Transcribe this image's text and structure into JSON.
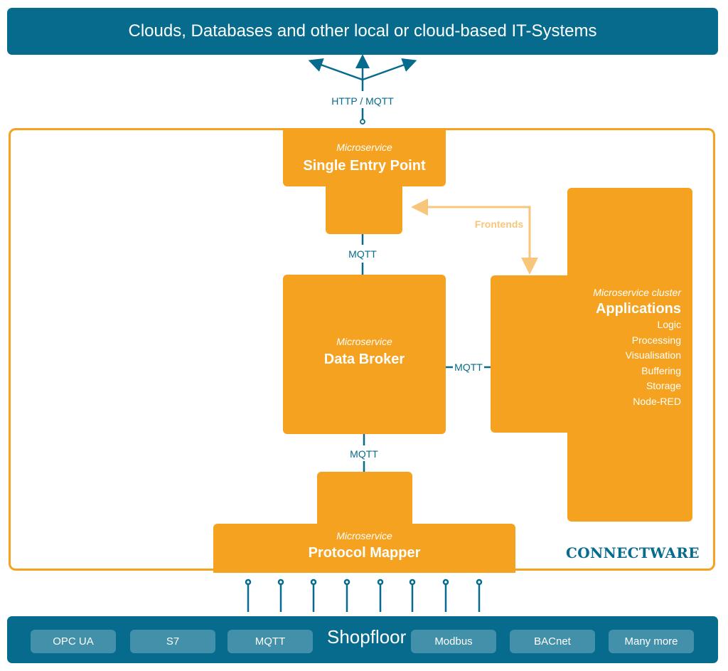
{
  "top_system": {
    "title": "Clouds, Databases and other local or cloud-based IT-Systems"
  },
  "connections": {
    "top": "HTTP / MQTT",
    "sep_to_broker": "MQTT",
    "broker_to_apps": "MQTT",
    "broker_to_mapper": "MQTT",
    "frontends": "Frontends"
  },
  "services": {
    "single_entry_point": {
      "kind": "Microservice",
      "name": "Single Entry Point"
    },
    "data_broker": {
      "kind": "Microservice",
      "name": "Data Broker"
    },
    "protocol_mapper": {
      "kind": "Microservice",
      "name": "Protocol Mapper"
    },
    "applications": {
      "kind": "Microservice cluster",
      "name": "Applications",
      "items": [
        "Logic",
        "Processing",
        "Visualisation",
        "Buffering",
        "Storage",
        "Node-RED"
      ]
    }
  },
  "brand": "CONNECTWARE",
  "shopfloor": {
    "title": "Shopfloor",
    "protocols_left": [
      "OPC UA",
      "S7",
      "MQTT"
    ],
    "protocols_right": [
      "Modbus",
      "BACnet",
      "Many more"
    ]
  },
  "colors": {
    "blue": "#066b8c",
    "orange": "#f4a21f",
    "light_orange": "#f8c67a",
    "chip": "#4290aa"
  }
}
